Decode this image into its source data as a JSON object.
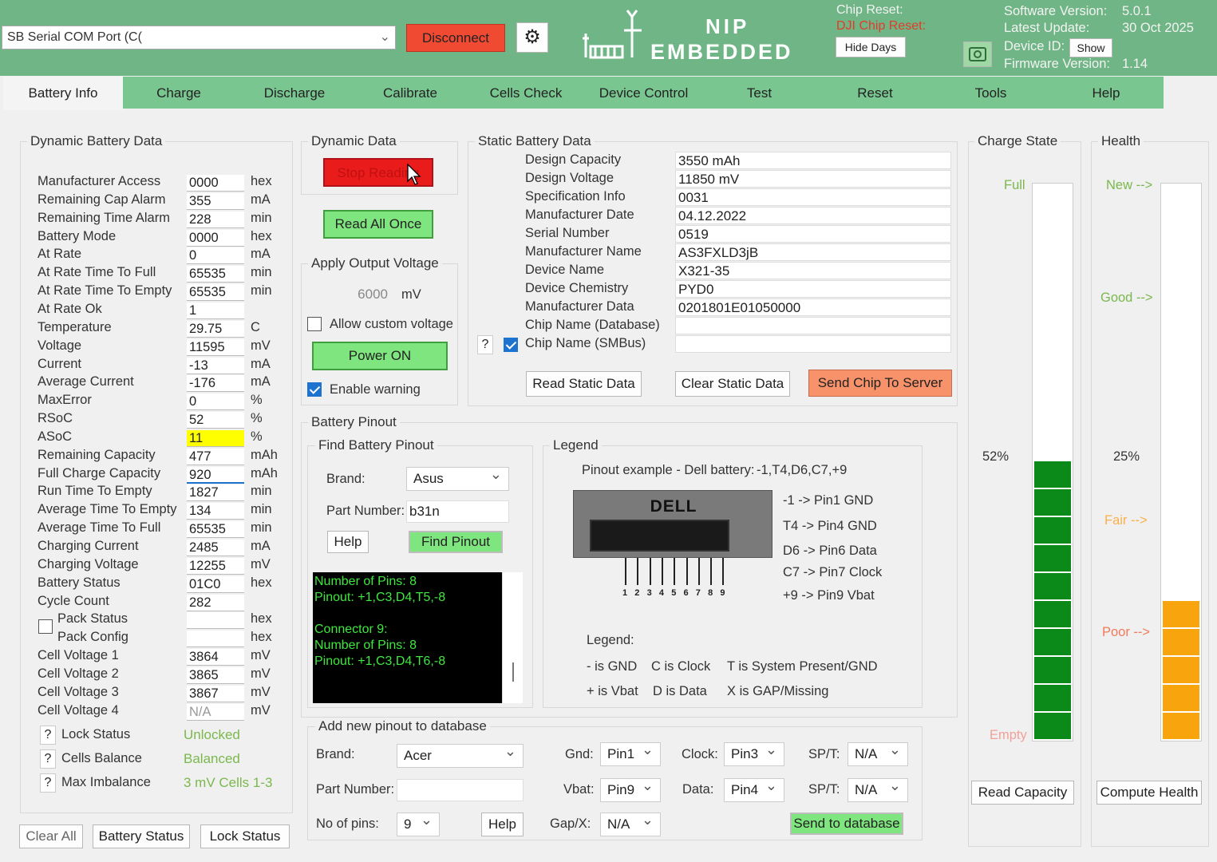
{
  "header": {
    "port_label": "SB Serial COM Port (C(",
    "disconnect": "Disconnect",
    "logo_top": "NIP",
    "logo_bottom": "EMBEDDED",
    "chip_reset": "Chip Reset:",
    "dji_chip_reset": "DJI Chip Reset:",
    "hide_days": "Hide Days",
    "sw_version_label": "Software Version:",
    "sw_version": "5.0.1",
    "latest_update_label": "Latest Update:",
    "latest_update": "30 Oct 2025",
    "device_id_label": "Device ID:",
    "show": "Show",
    "fw_version_label": "Firmware Version:",
    "fw_version": "1.14",
    "colors": {
      "header": "#6fb585",
      "disconnect": "#f14a33"
    }
  },
  "tabs": [
    "Battery Info",
    "Charge",
    "Discharge",
    "Calibrate",
    "Cells Check",
    "Device Control",
    "Test",
    "Reset",
    "Tools",
    "Help"
  ],
  "dynamic_battery": {
    "title": "Dynamic Battery Data",
    "rows": [
      {
        "label": "Manufacturer Access",
        "value": "0000",
        "unit": "hex"
      },
      {
        "label": "Remaining Cap Alarm",
        "value": "355",
        "unit": "mA"
      },
      {
        "label": "Remaining Time Alarm",
        "value": "228",
        "unit": "min"
      },
      {
        "label": "Battery Mode",
        "value": "0000",
        "unit": "hex"
      },
      {
        "label": "At Rate",
        "value": "0",
        "unit": "mA"
      },
      {
        "label": "At Rate Time To Full",
        "value": "65535",
        "unit": "min"
      },
      {
        "label": "At Rate Time To Empty",
        "value": "65535",
        "unit": "min"
      },
      {
        "label": "At Rate Ok",
        "value": "1",
        "unit": ""
      },
      {
        "label": "Temperature",
        "value": "29.75",
        "unit": "C"
      },
      {
        "label": "Voltage",
        "value": "11595",
        "unit": "mV"
      },
      {
        "label": "Current",
        "value": "-13",
        "unit": "mA"
      },
      {
        "label": "Average Current",
        "value": "-176",
        "unit": "mA"
      },
      {
        "label": "MaxError",
        "value": "0",
        "unit": "%"
      },
      {
        "label": "RSoC",
        "value": "52",
        "unit": "%"
      },
      {
        "label": "ASoC",
        "value": "11",
        "unit": "%"
      },
      {
        "label": "Remaining Capacity",
        "value": "477",
        "unit": "mAh"
      },
      {
        "label": "Full Charge Capacity",
        "value": "920",
        "unit": "mAh"
      },
      {
        "label": "Run Time To Empty",
        "value": "1827",
        "unit": "min"
      },
      {
        "label": "Average Time To Empty",
        "value": "134",
        "unit": "min"
      },
      {
        "label": "Average Time To Full",
        "value": "65535",
        "unit": "min"
      },
      {
        "label": "Charging Current",
        "value": "2485",
        "unit": "mA"
      },
      {
        "label": "Charging Voltage",
        "value": "12255",
        "unit": "mV"
      },
      {
        "label": "Battery Status",
        "value": "01C0",
        "unit": "hex"
      },
      {
        "label": "Cycle Count",
        "value": "282",
        "unit": ""
      },
      {
        "label": "Pack Status",
        "value": "",
        "unit": "hex"
      },
      {
        "label": "Pack Config",
        "value": "",
        "unit": "hex"
      },
      {
        "label": "Cell Voltage 1",
        "value": "3864",
        "unit": "mV"
      },
      {
        "label": "Cell Voltage 2",
        "value": "3865",
        "unit": "mV"
      },
      {
        "label": "Cell Voltage 3",
        "value": "3867",
        "unit": "mV"
      },
      {
        "label": "Cell Voltage 4",
        "value": "N/A",
        "unit": "mV"
      }
    ],
    "lock_status_label": "Lock Status",
    "lock_status": "Unlocked",
    "cells_balance_label": "Cells Balance",
    "cells_balance": "Balanced",
    "max_imbalance_label": "Max Imbalance",
    "max_imbalance": "3 mV Cells 1-3",
    "q": "?",
    "clear_all": "Clear All",
    "battery_status_btn": "Battery Status",
    "lock_status_btn": "Lock Status"
  },
  "dynamic_data": {
    "title": "Dynamic Data",
    "stop_reading": "Stop Reading",
    "read_all_once": "Read All Once",
    "apply_voltage_title": "Apply Output Voltage",
    "voltage": "6000",
    "voltage_unit": "mV",
    "allow_custom": "Allow custom voltage",
    "power_on": "Power ON",
    "enable_warning": "Enable warning"
  },
  "static": {
    "title": "Static Battery Data",
    "rows": [
      {
        "label": "Design Capacity",
        "value": "3550 mAh"
      },
      {
        "label": "Design Voltage",
        "value": "11850 mV"
      },
      {
        "label": "Specification Info",
        "value": "0031"
      },
      {
        "label": "Manufacturer Date",
        "value": "04.12.2022"
      },
      {
        "label": "Serial Number",
        "value": "0519"
      },
      {
        "label": "Manufacturer Name",
        "value": "AS3FXLD3jB"
      },
      {
        "label": "Device Name",
        "value": "X321-35"
      },
      {
        "label": "Device Chemistry",
        "value": "PYD0"
      },
      {
        "label": "Manufacturer Data",
        "value": "0201801E01050000"
      },
      {
        "label": "Chip Name (Database)",
        "value": ""
      },
      {
        "label": "Chip Name (SMBus)",
        "value": ""
      }
    ],
    "read_static": "Read Static Data",
    "clear_static": "Clear Static Data",
    "send_chip": "Send Chip To Server"
  },
  "pinout": {
    "title": "Battery Pinout",
    "find_title": "Find Battery Pinout",
    "brand_label": "Brand:",
    "brand": "Asus",
    "part_label": "Part Number:",
    "part": "b31n",
    "help": "Help",
    "find": "Find Pinout",
    "console": [
      "Number of Pins:  8",
      "Pinout:  +1,C3,D4,T5,-8",
      "",
      "Connector 9:",
      "Number of Pins:  8",
      "Pinout:  +1,C3,D4,T6,-8"
    ],
    "legend_title": "Legend",
    "example_label": "Pinout example - Dell battery:",
    "example_value": "-1,T4,D6,C7,+9",
    "dell": "DELL",
    "pin_numbers": [
      "1",
      "2",
      "3",
      "4",
      "5",
      "6",
      "7",
      "8",
      "9"
    ],
    "mappings": [
      "-1 -> Pin1 GND",
      "T4 -> Pin4 GND",
      "D6 -> Pin6 Data",
      "C7 -> Pin7 Clock",
      "+9 -> Pin9 Vbat"
    ],
    "legend_label": "Legend:",
    "legend_items": [
      "- is GND",
      "C is Clock",
      "T is System Present/GND",
      "+ is Vbat",
      "D is Data",
      "X is GAP/Missing"
    ]
  },
  "addpinout": {
    "title": "Add new pinout to database",
    "brand_label": "Brand:",
    "brand": "Acer",
    "part_label": "Part Number:",
    "part": "",
    "pins_label": "No of pins:",
    "pins": "9",
    "help": "Help",
    "gnd_label": "Gnd:",
    "gnd": "Pin1",
    "clock_label": "Clock:",
    "clock": "Pin3",
    "spt_label": "SP/T:",
    "spt1": "N/A",
    "vbat_label": "Vbat:",
    "vbat": "Pin9",
    "data_label": "Data:",
    "data": "Pin4",
    "spt2": "N/A",
    "gap_label": "Gap/X:",
    "gap": "N/A",
    "send": "Send to database"
  },
  "charge_state": {
    "title": "Charge State",
    "full": "Full",
    "empty": "Empty",
    "percent_label": "52%",
    "level": 0.52,
    "read_capacity": "Read Capacity",
    "color": "#0b8a1a"
  },
  "health": {
    "title": "Health",
    "new": "New -->",
    "good": "Good -->",
    "fair": "Fair -->",
    "poor": "Poor -->",
    "percent_label": "25%",
    "level": 0.25,
    "compute": "Compute Health",
    "color": "#f8a40c"
  }
}
